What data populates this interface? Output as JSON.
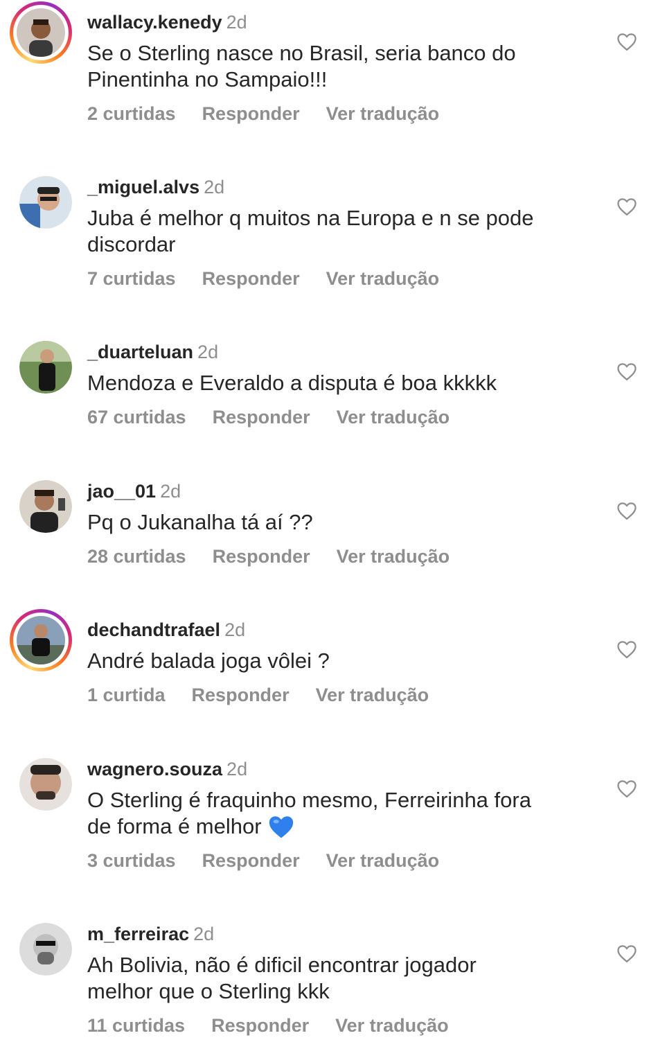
{
  "comments": [
    {
      "username": "wallacy.kenedy",
      "time": "2d",
      "line1": "Se o Sterling nasce no Brasil, seria banco do",
      "line2": "Pinentinha no Sampaio!!!",
      "likes": "2 curtidas",
      "reply": "Responder",
      "translate": "Ver tradução",
      "story_ring": true
    },
    {
      "username": "_miguel.alvs",
      "time": "2d",
      "line1": "Juba é melhor q muitos na Europa e n se pode",
      "line2": "discordar",
      "likes": "7 curtidas",
      "reply": "Responder",
      "translate": "Ver tradução",
      "story_ring": false
    },
    {
      "username": "_duarteluan",
      "time": "2d",
      "line1": "Mendoza e Everaldo a disputa é boa kkkkk",
      "line2": "",
      "likes": "67 curtidas",
      "reply": "Responder",
      "translate": "Ver tradução",
      "story_ring": false
    },
    {
      "username": "jao__01",
      "time": "2d",
      "line1": "Pq o Jukanalha tá aí ??",
      "line2": "",
      "likes": "28 curtidas",
      "reply": "Responder",
      "translate": "Ver tradução",
      "story_ring": false
    },
    {
      "username": "dechandtrafael",
      "time": "2d",
      "line1": "André balada joga vôlei ?",
      "line2": "",
      "likes": "1 curtida",
      "reply": "Responder",
      "translate": "Ver tradução",
      "story_ring": true
    },
    {
      "username": "wagnero.souza",
      "time": "2d",
      "line1": "O Sterling é fraquinho mesmo, Ferreirinha fora",
      "line2": "de forma é melhor",
      "emoji": "blue-heart",
      "likes": "3 curtidas",
      "reply": "Responder",
      "translate": "Ver tradução",
      "story_ring": false
    },
    {
      "username": "m_ferreirac",
      "time": "2d",
      "line1": "Ah Bolivia, não é dificil encontrar jogador",
      "line2": "melhor que o Sterling kkk",
      "likes": "11 curtidas",
      "reply": "Responder",
      "translate": "Ver tradução",
      "story_ring": false
    }
  ],
  "colors": {
    "text": "#262626",
    "secondary": "#8e8e8e",
    "emoji_heart": "#2f80ed"
  },
  "icons": {
    "like": "heart-outline-icon",
    "emoji": "blue-heart-emoji"
  }
}
